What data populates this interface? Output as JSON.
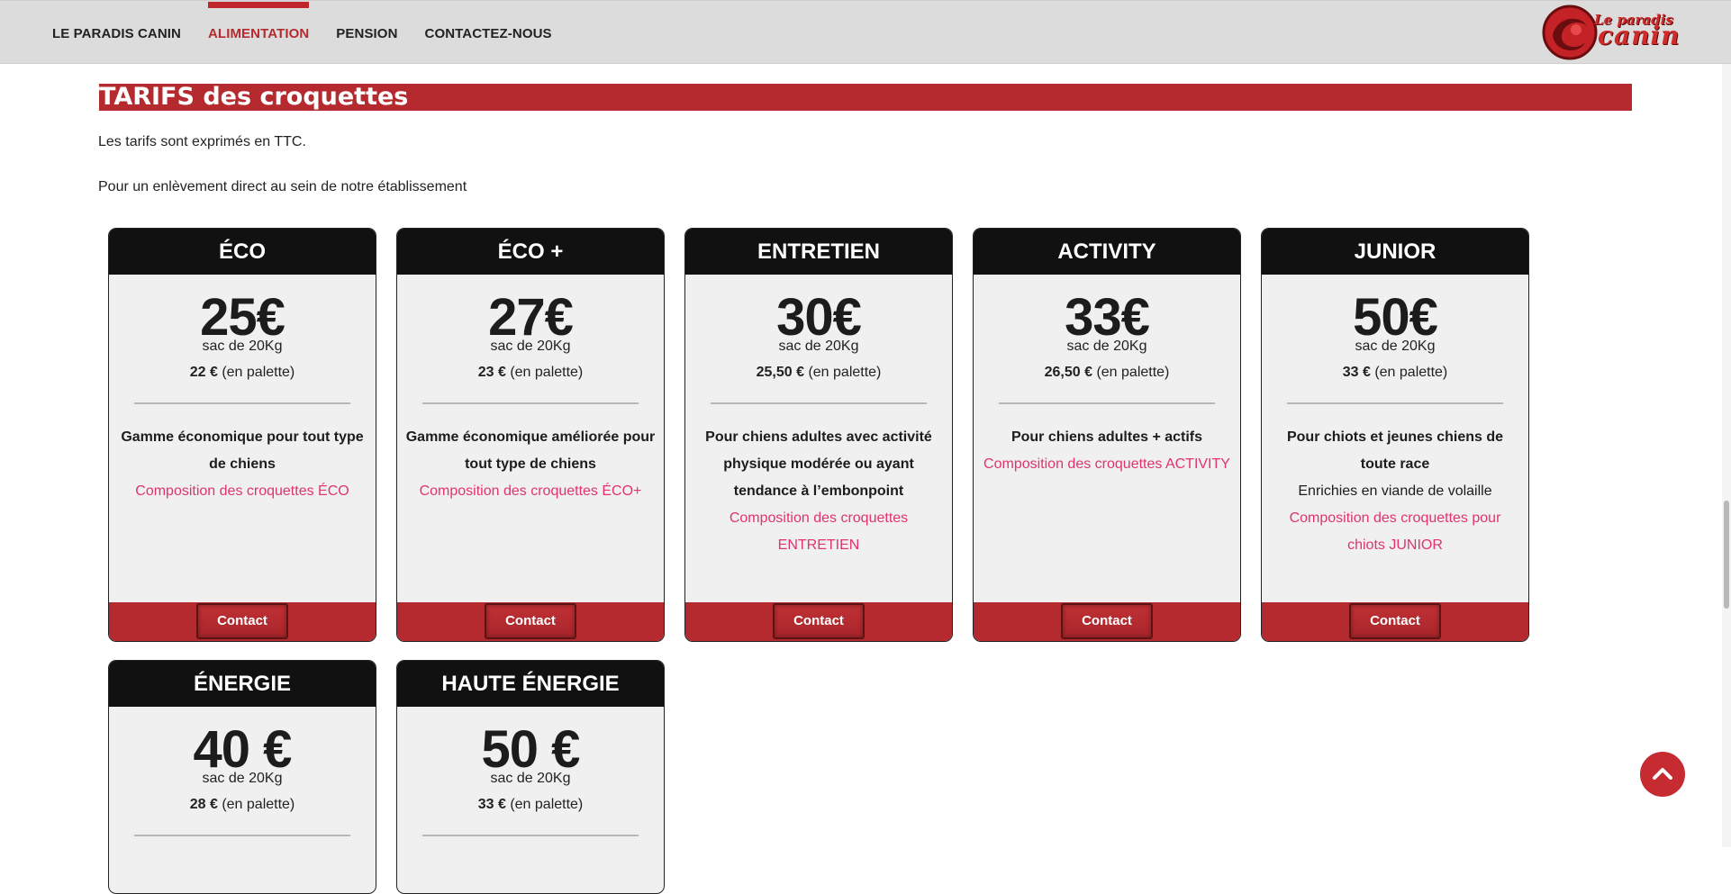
{
  "nav": {
    "items": [
      {
        "label": "LE PARADIS CANIN",
        "active": false
      },
      {
        "label": "ALIMENTATION",
        "active": true
      },
      {
        "label": "PENSION",
        "active": false
      },
      {
        "label": "CONTACTEZ-NOUS",
        "active": false
      }
    ],
    "logo": {
      "line1": "Le paradis",
      "line2": "canin"
    }
  },
  "section": {
    "title": "TARIFS des croquettes",
    "intro1": "Les tarifs sont exprimés en TTC.",
    "intro2": "Pour un enlèvement direct au sein de notre établissement"
  },
  "cards": [
    {
      "name": "ÉCO",
      "price": "25€",
      "unit": "sac de 20Kg",
      "palette_price": "22 €",
      "palette_suffix": " (en palette)",
      "description": "Gamme économique pour tout type de chiens",
      "subtitle": "",
      "composition": "Composition des croquettes ÉCO",
      "button": "Contact"
    },
    {
      "name": "ÉCO +",
      "price": "27€",
      "unit": "sac de 20Kg",
      "palette_price": "23 €",
      "palette_suffix": " (en palette)",
      "description": "Gamme économique améliorée pour tout type de chiens",
      "subtitle": "",
      "composition": "Composition des croquettes ÉCO+",
      "button": "Contact"
    },
    {
      "name": "ENTRETIEN",
      "price": "30€",
      "unit": "sac de 20Kg",
      "palette_price": "25,50 €",
      "palette_suffix": " (en palette)",
      "description": "Pour chiens adultes avec activité physique modérée ou ayant tendance à l’embonpoint",
      "subtitle": "",
      "composition": "Composition des croquettes ENTRETIEN",
      "button": "Contact"
    },
    {
      "name": "ACTIVITY",
      "price": "33€",
      "unit": "sac de 20Kg",
      "palette_price": "26,50 €",
      "palette_suffix": " (en palette)",
      "description": "Pour chiens adultes  + actifs",
      "subtitle": "",
      "composition": "Composition des croquettes ACTIVITY",
      "button": "Contact"
    },
    {
      "name": "JUNIOR",
      "price": "50€",
      "unit": "sac de 20Kg",
      "palette_price": "33 €",
      "palette_suffix": " (en palette)",
      "description": "Pour chiots et jeunes chiens de toute race",
      "subtitle": "Enrichies en viande de volaille",
      "composition": "Composition des croquettes pour chiots JUNIOR",
      "button": "Contact"
    },
    {
      "name": "ÉNERGIE",
      "price": "40 €",
      "unit": "sac de 20Kg",
      "palette_price": "28 €",
      "palette_suffix": " (en palette)"
    },
    {
      "name": "HAUTE ÉNERGIE",
      "price": "50 €",
      "unit": "sac de 20Kg",
      "palette_price": "33 €",
      "palette_suffix": " (en palette)"
    }
  ],
  "colors": {
    "accent": "#b52a2e",
    "link": "#e0336f",
    "card_header": "#111111",
    "card_body": "#f0f0f0",
    "nav_bg": "#dcdcdc"
  },
  "icons": {
    "scroll_top": "chevron-up-icon"
  }
}
